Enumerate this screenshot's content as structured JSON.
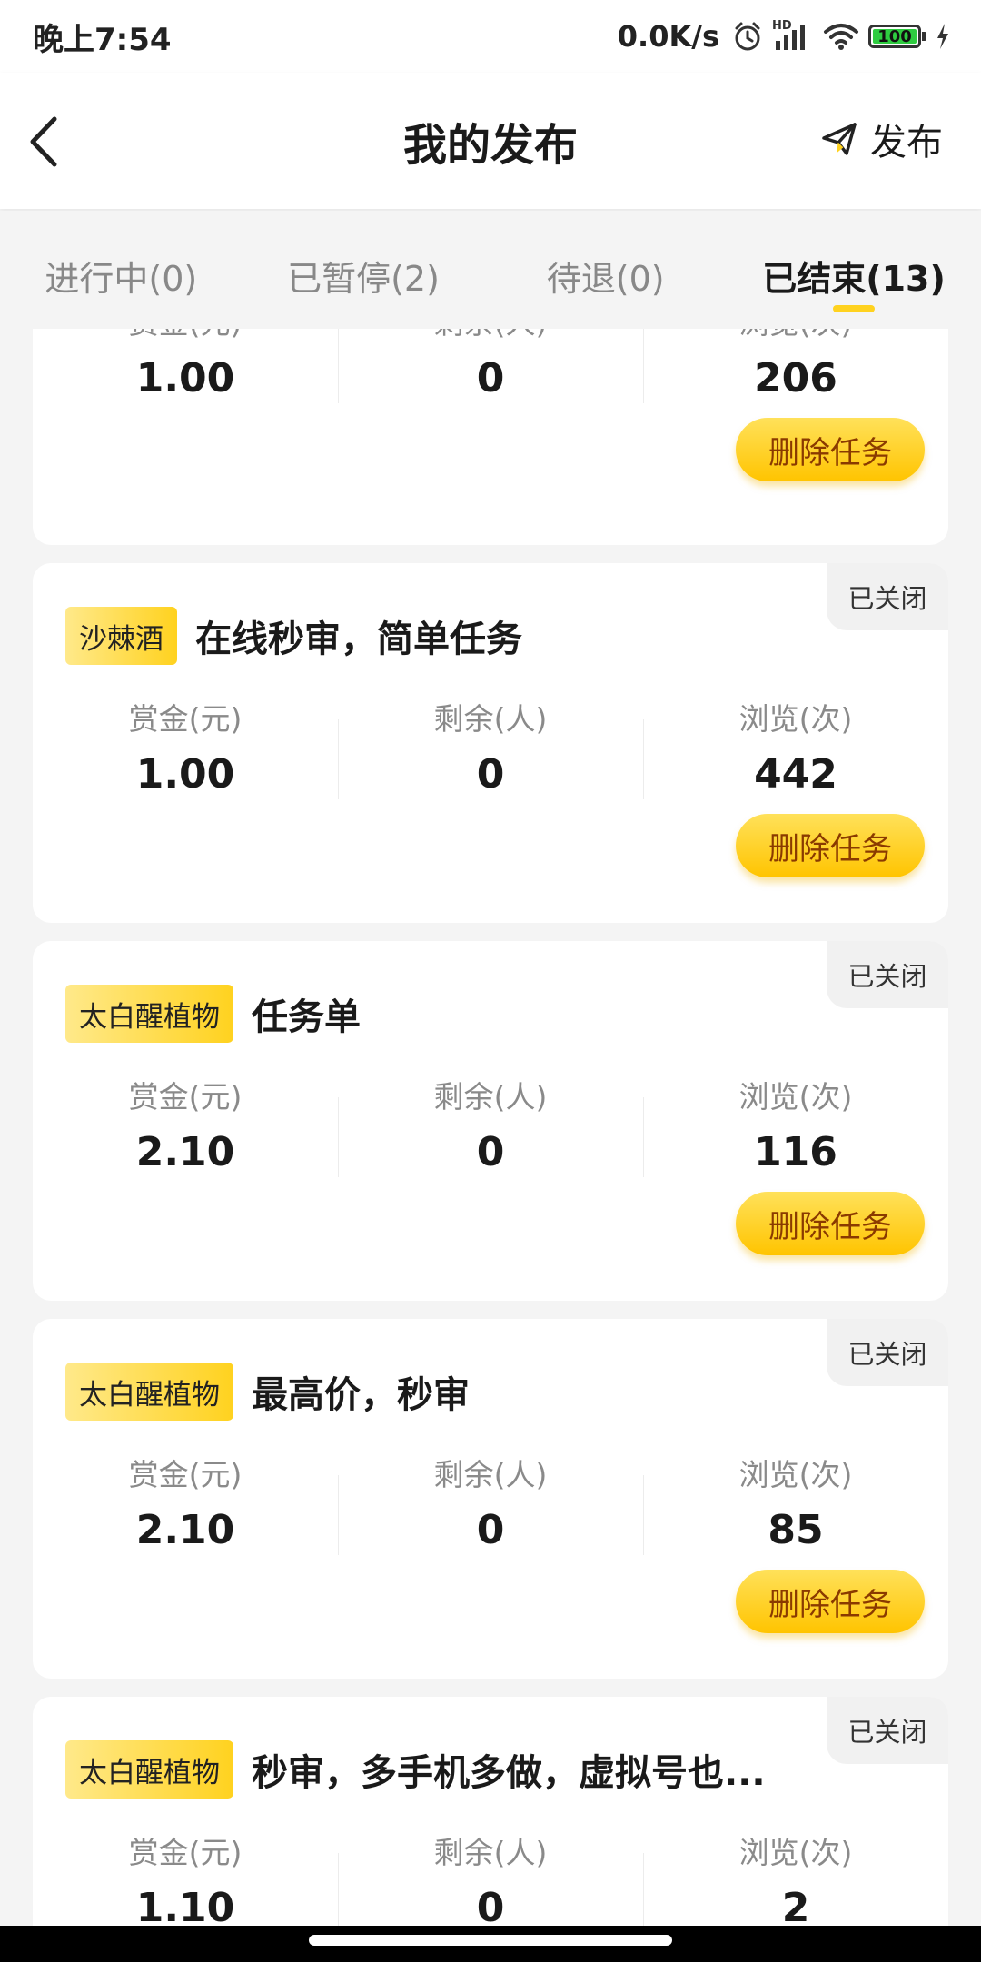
{
  "status_bar": {
    "time": "晚上7:54",
    "net_speed": "0.0K/s",
    "battery": "100",
    "hd_label": "HD",
    "icons": [
      "alarm-icon",
      "hd-signal-icon",
      "wifi-icon",
      "battery-icon",
      "charging-icon"
    ]
  },
  "header": {
    "title": "我的发布",
    "publish_label": "发布",
    "icons": [
      "back-arrow-icon",
      "paper-plane-icon"
    ]
  },
  "tabs": [
    {
      "label": "进行中(0)"
    },
    {
      "label": "已暂停(2)"
    },
    {
      "label": "待退(0)"
    },
    {
      "label": "已结束(13)",
      "active": true
    }
  ],
  "stat_labels": {
    "reward": "赏金(元)",
    "remaining": "剩余(人)",
    "views": "浏览(次)"
  },
  "delete_label": "删除任务",
  "colors": {
    "accent": "#ffd21f",
    "button_text": "#8a3a00"
  },
  "cards": [
    {
      "status": "",
      "tag": "",
      "title": "",
      "reward": "1.00",
      "remaining": "0",
      "views": "206"
    },
    {
      "status": "已关闭",
      "tag": "沙棘酒",
      "title": "在线秒审，简单任务",
      "reward": "1.00",
      "remaining": "0",
      "views": "442"
    },
    {
      "status": "已关闭",
      "tag": "太白醒植物",
      "title": "任务单",
      "reward": "2.10",
      "remaining": "0",
      "views": "116"
    },
    {
      "status": "已关闭",
      "tag": "太白醒植物",
      "title": "最高价，秒审",
      "reward": "2.10",
      "remaining": "0",
      "views": "85"
    },
    {
      "status": "已关闭",
      "tag": "太白醒植物",
      "title": "秒审，多手机多做，虚拟号也...",
      "reward": "1.10",
      "remaining": "0",
      "views": "2"
    }
  ]
}
